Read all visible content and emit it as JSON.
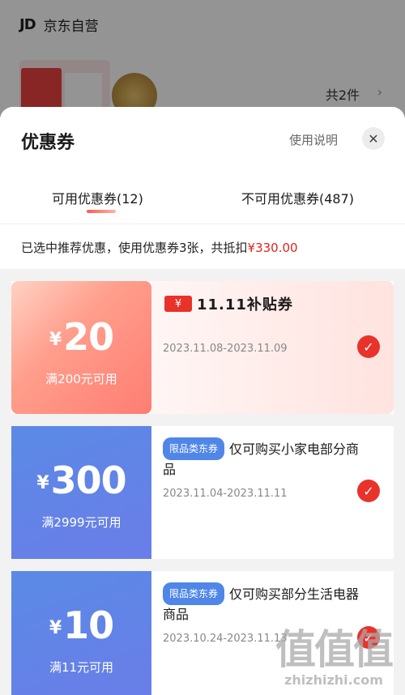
{
  "background": {
    "store_logo": "JD",
    "store_name": "京东自营",
    "item_count": "共2件",
    "arrow": "›"
  },
  "sheet": {
    "title": "优惠券",
    "help": "使用说明",
    "close": "✕",
    "tabs": [
      {
        "label": "可用优惠券(12)"
      },
      {
        "label": "不可用优惠券(487)"
      }
    ],
    "summary_prefix": "已选中推荐优惠，使用优惠券3张，共抵扣",
    "summary_amount": "¥330.00"
  },
  "coupons": [
    {
      "currency": "¥",
      "amount": "20",
      "condition": "满200元可用",
      "badge_symbol": "¥",
      "badge_text": "11.11补贴券",
      "date": "2023.11.08-2023.11.09",
      "checked": "✓"
    },
    {
      "currency": "¥",
      "amount": "300",
      "condition": "满2999元可用",
      "tag": "限品类东券",
      "description": "仅可购买小家电部分商品",
      "date": "2023.11.04-2023.11.11",
      "checked": "✓"
    },
    {
      "currency": "¥",
      "amount": "10",
      "condition": "满11元可用",
      "tag": "限品类东券",
      "description": "仅可购买部分生活电器商品",
      "date": "2023.10.24-2023.11.13",
      "checked": "✓"
    }
  ],
  "watermark": {
    "big": "值值值",
    "small": "zhizhizhi.com"
  },
  "colors": {
    "accent_red": "#e8322a",
    "tag_blue": "#4f86e8"
  }
}
